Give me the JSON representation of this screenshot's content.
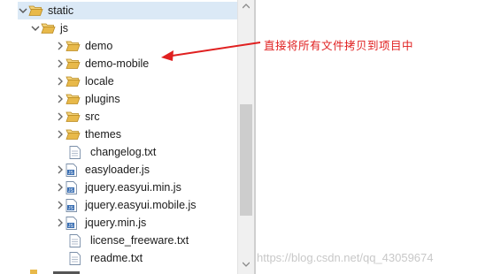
{
  "tree": {
    "static": "static",
    "js": "js",
    "folders": [
      "demo",
      "demo-mobile",
      "locale",
      "plugins",
      "src",
      "themes"
    ],
    "files": [
      {
        "name": "changelog.txt",
        "type": "txt"
      },
      {
        "name": "easyloader.js",
        "type": "js"
      },
      {
        "name": "jquery.easyui.min.js",
        "type": "js"
      },
      {
        "name": "jquery.easyui.mobile.js",
        "type": "js"
      },
      {
        "name": "jquery.min.js",
        "type": "js"
      },
      {
        "name": "license_freeware.txt",
        "type": "txt"
      },
      {
        "name": "readme.txt",
        "type": "txt"
      }
    ]
  },
  "annotation": {
    "text": "直接将所有文件拷贝到项目中",
    "color": "#e02020"
  },
  "watermark": "https://blog.csdn.net/qq_43059674",
  "colors": {
    "folder": "#e8b94a",
    "selection": "#dbe9f6"
  }
}
